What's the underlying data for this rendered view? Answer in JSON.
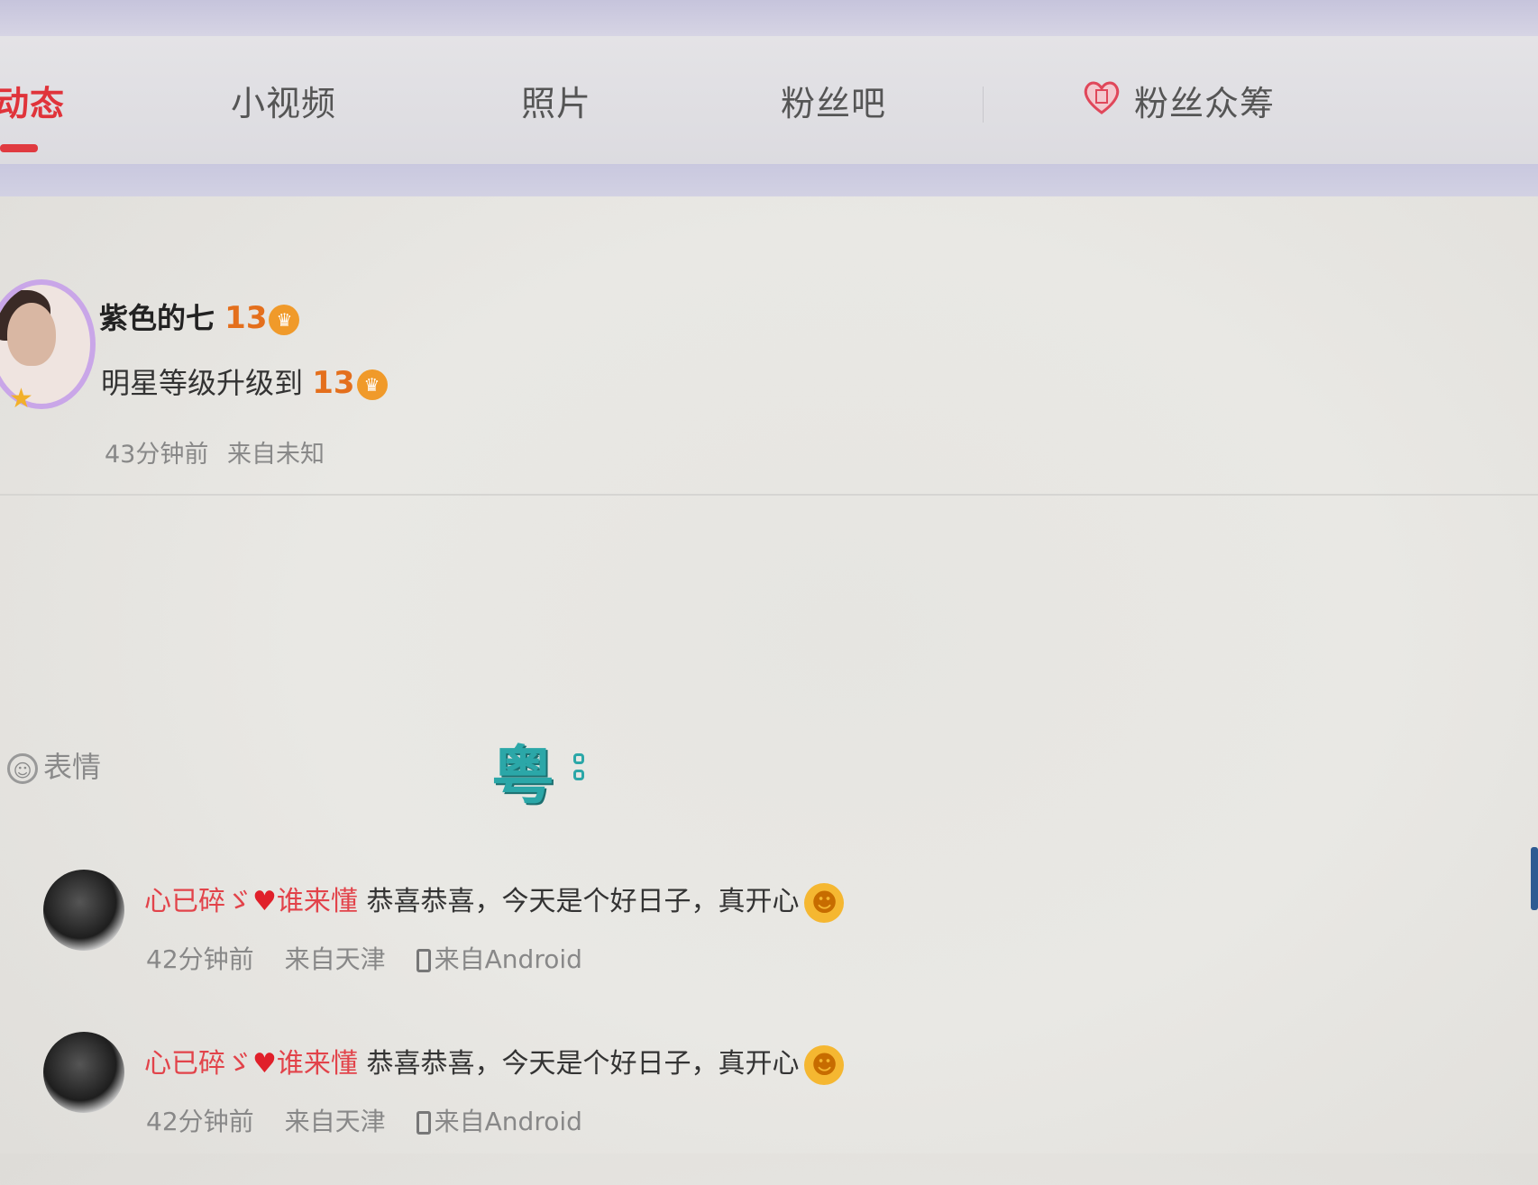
{
  "tabs": [
    {
      "label": "动态",
      "active": true
    },
    {
      "label": "小视频",
      "active": false
    },
    {
      "label": "照片",
      "active": false
    },
    {
      "label": "粉丝吧",
      "active": false
    },
    {
      "label": "粉丝众筹",
      "active": false
    }
  ],
  "post": {
    "author": "紫色的七",
    "level": "13",
    "body_text": "明星等级升级到",
    "body_level": "13",
    "time": "43分钟前",
    "source": "来自未知"
  },
  "input_bar": {
    "emoji_label": "表情",
    "ime_icon": "粤"
  },
  "comments": [
    {
      "user": "心已碎ゞ",
      "user_suffix": "谁来懂",
      "text": "恭喜恭喜，今天是个好日子，真开心",
      "time": "42分钟前",
      "location": "来自天津",
      "device": "来自Android"
    },
    {
      "user": "心已碎ゞ",
      "user_suffix": "谁来懂",
      "text": "恭喜恭喜，今天是个好日子，真开心",
      "time": "42分钟前",
      "location": "来自天津",
      "device": "来自Android"
    }
  ],
  "colors": {
    "accent": "#e0333a",
    "level": "#e46f1c",
    "ime": "#2ba7a8",
    "band": "#c9c8df"
  }
}
